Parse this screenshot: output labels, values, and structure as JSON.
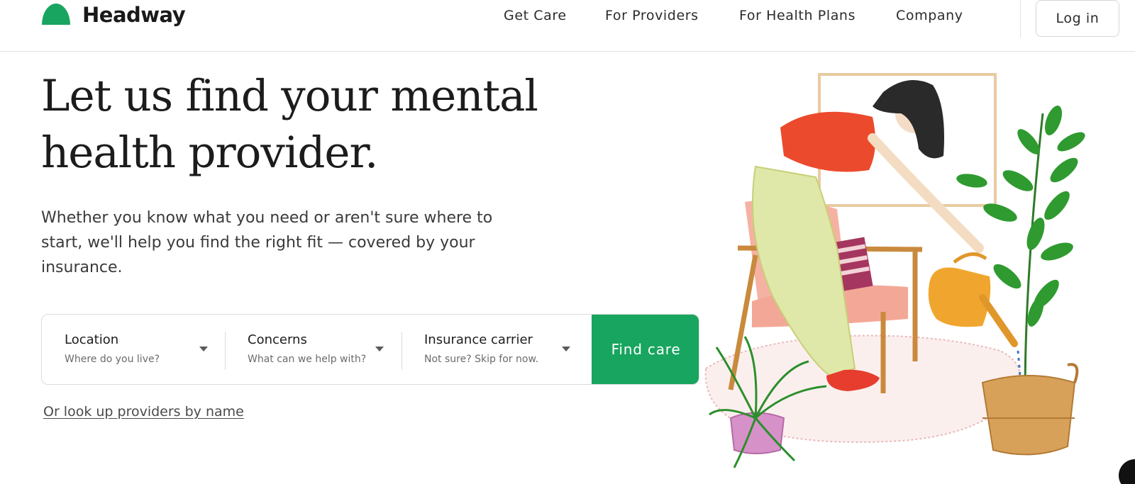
{
  "brand": {
    "name": "Headway",
    "color": "#18a55f"
  },
  "nav": {
    "items": [
      {
        "label": "Get Care"
      },
      {
        "label": "For Providers"
      },
      {
        "label": "For Health Plans"
      },
      {
        "label": "Company"
      }
    ],
    "login_label": "Log in"
  },
  "hero": {
    "headline": "Let us find your mental health provider.",
    "subtext": "Whether you know what you need or aren't sure where to start, we'll help you find the right fit — covered by your insurance."
  },
  "search": {
    "fields": [
      {
        "label": "Location",
        "hint": "Where do you live?",
        "icon": "chevron-down-icon"
      },
      {
        "label": "Concerns",
        "hint": "What can we help with?",
        "icon": "chevron-down-icon"
      },
      {
        "label": "Insurance carrier",
        "hint": "Not sure? Skip for now.",
        "icon": "chevron-down-icon"
      }
    ],
    "submit_label": "Find care"
  },
  "lookup_link": "Or look up providers by name",
  "illustration": {
    "subject": "watercolor-woman-watering-plant",
    "icon": "illustration"
  },
  "chat_widget": {
    "icon": "chat-icon"
  }
}
